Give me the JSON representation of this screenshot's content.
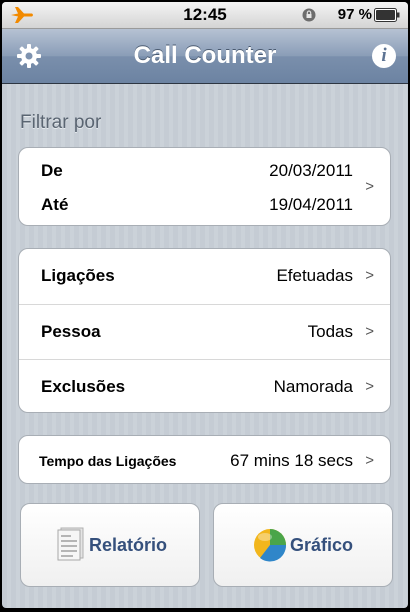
{
  "status_bar": {
    "time": "12:45",
    "battery": "97 %",
    "icons": [
      "airplane-icon",
      "lock-rotation-icon",
      "battery-icon"
    ]
  },
  "nav": {
    "title": "Call Counter",
    "left_icon": "gear-icon",
    "right_icon": "info-icon"
  },
  "filter": {
    "section_label": "Filtrar por",
    "from_label": "De",
    "from_value": "20/03/2011",
    "to_label": "Até",
    "to_value": "19/04/2011"
  },
  "options": [
    {
      "label": "Ligações",
      "value": "Efetuadas"
    },
    {
      "label": "Pessoa",
      "value": "Todas"
    },
    {
      "label": "Exclusões",
      "value": "Namorada"
    }
  ],
  "duration": {
    "label": "Tempo das Ligações",
    "value": "67 mins 18 secs"
  },
  "buttons": {
    "report_label": "Relatório",
    "report_icon": "document-icon",
    "chart_label": "Gráfico",
    "chart_icon": "pie-chart-icon"
  },
  "chevron": ">",
  "colors": {
    "nav_bar": "#7a8fac",
    "button_text": "#35507c",
    "background": "#c5ccd4"
  }
}
